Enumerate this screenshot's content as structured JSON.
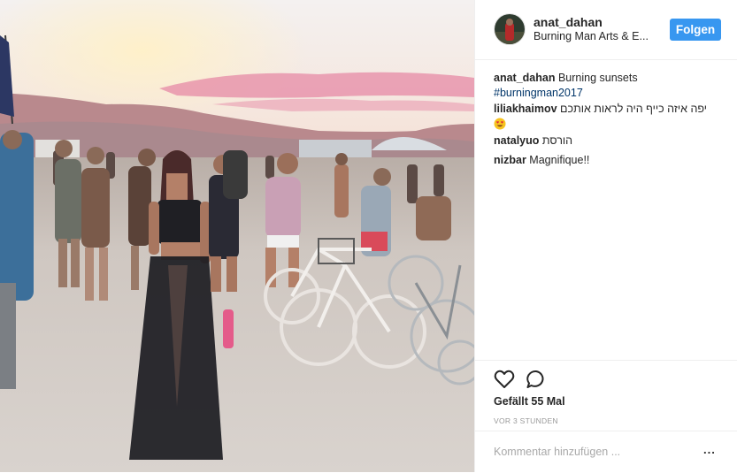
{
  "post": {
    "username": "anat_dahan",
    "location": "Burning Man Arts & E...",
    "follow_label": "Folgen"
  },
  "caption": {
    "user": "anat_dahan",
    "text": "Burning sunsets",
    "hashtag": "#burningman2017"
  },
  "comments": [
    {
      "user": "liliakhaimov",
      "text": "יפה איזה כייף היה לראות אותכם",
      "emoji": "heart-eyes-emoji"
    },
    {
      "user": "natalyuo",
      "text": "הורסת"
    },
    {
      "user": "nizbar",
      "text": "Magnifique!!"
    }
  ],
  "stats": {
    "likes": "Gefällt 55 Mal",
    "time": "VOR 3 STUNDEN"
  },
  "comment_box": {
    "placeholder": "Kommentar hinzufügen ...",
    "more": "..."
  },
  "colors": {
    "accent": "#3897f0",
    "hashtag": "#003569",
    "text": "#262626",
    "muted": "#999999"
  },
  "icons": [
    "heart-icon",
    "comment-icon",
    "more-options-icon"
  ]
}
